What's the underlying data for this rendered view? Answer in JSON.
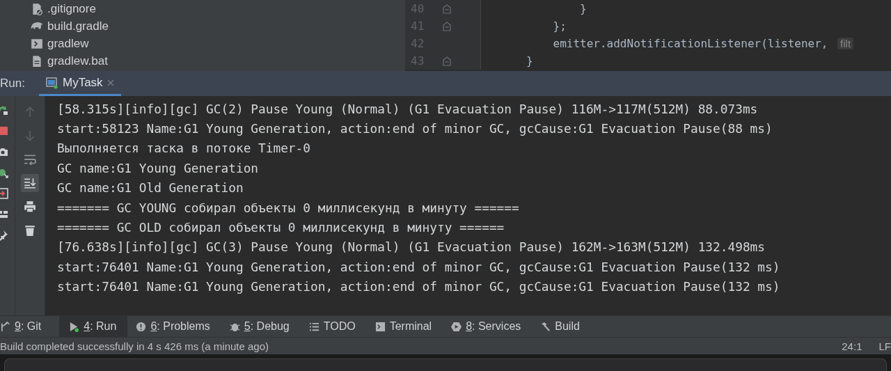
{
  "project_tree": {
    "items": [
      {
        "name": ".gitignore",
        "kind": "ignore"
      },
      {
        "name": "build.gradle",
        "kind": "gradle"
      },
      {
        "name": "gradlew",
        "kind": "script"
      },
      {
        "name": "gradlew.bat",
        "kind": "text"
      }
    ]
  },
  "editor": {
    "lines": [
      {
        "number": "40",
        "code": "        }",
        "fold": true
      },
      {
        "number": "41",
        "code": "    };",
        "fold": true
      },
      {
        "number": "42",
        "code": "    emitter.addNotificationListener(listener, ",
        "hint": "filt",
        "fold": false
      },
      {
        "number": "43",
        "code": "}",
        "fold": true
      }
    ]
  },
  "run": {
    "label": "Run:",
    "tabs": [
      {
        "label": "MyTask",
        "selected": true
      }
    ],
    "side_tools": [
      {
        "kind": "rerun"
      },
      {
        "kind": "stop"
      },
      {
        "kind": "camera"
      },
      {
        "kind": "debug"
      },
      {
        "kind": "exit"
      },
      {
        "kind": "layout"
      },
      {
        "kind": "pin"
      }
    ],
    "console_tools": [
      {
        "kind": "up",
        "selected": false
      },
      {
        "kind": "down",
        "selected": false
      },
      {
        "kind": "wrap",
        "selected": false
      },
      {
        "kind": "scroll-end",
        "selected": true
      },
      {
        "kind": "print",
        "selected": false
      },
      {
        "kind": "trash",
        "selected": false
      }
    ],
    "console": {
      "lines": [
        "[58.315s][info][gc] GC(2) Pause Young (Normal) (G1 Evacuation Pause) 116M->117M(512M) 88.073ms",
        "start:58123 Name:G1 Young Generation, action:end of minor GC, gcCause:G1 Evacuation Pause(88 ms)",
        "Выполняется таска в потоке Timer-0",
        "GC name:G1 Young Generation",
        "GC name:G1 Old Generation",
        "======= GC YOUNG собирал объекты 0 миллисекунд в минуту ======",
        "======= GC OLD собирал объекты 0 миллисекунд в минуту ======",
        "[76.638s][info][gc] GC(3) Pause Young (Normal) (G1 Evacuation Pause) 162M->163M(512M) 132.498ms",
        "start:76401 Name:G1 Young Generation, action:end of minor GC, gcCause:G1 Evacuation Pause(132 ms)",
        "start:76401 Name:G1 Young Generation, action:end of minor GC, gcCause:G1 Evacuation Pause(132 ms)"
      ]
    }
  },
  "tool_windows": [
    {
      "kind": "git",
      "key": "9",
      "label": ": Git",
      "selected": false
    },
    {
      "kind": "run",
      "key": "4",
      "label": ": Run",
      "selected": true
    },
    {
      "kind": "problems",
      "key": "6",
      "label": ": Problems",
      "selected": false
    },
    {
      "kind": "debug",
      "key": "5",
      "label": ": Debug",
      "selected": false
    },
    {
      "kind": "todo",
      "label": "TODO",
      "selected": false
    },
    {
      "kind": "terminal",
      "label": "Terminal",
      "selected": false
    },
    {
      "kind": "services",
      "key": "8",
      "label": ": Services",
      "selected": false
    },
    {
      "kind": "build",
      "label": "Build",
      "selected": false
    }
  ],
  "status_bar": {
    "message": "Build completed successfully in 4 s 426 ms (a minute ago)",
    "position": "24:1",
    "line_separator": "LF"
  }
}
